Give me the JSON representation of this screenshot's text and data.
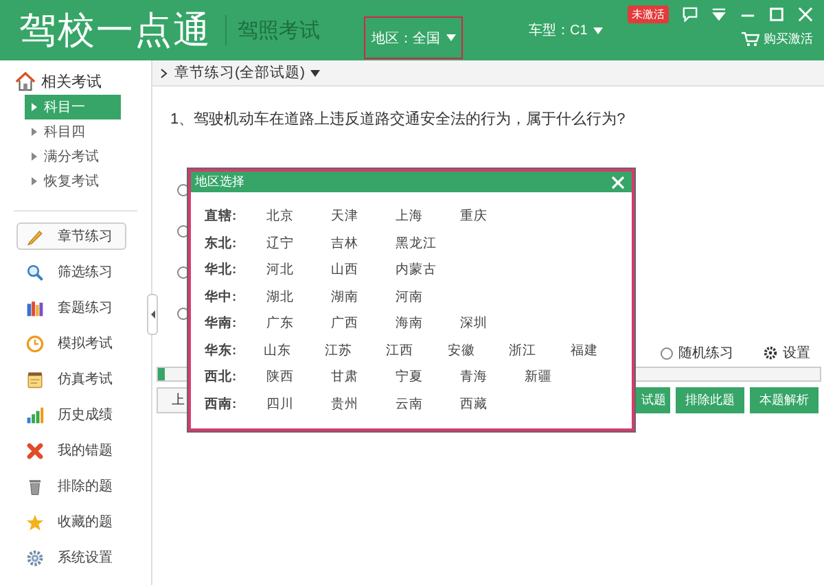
{
  "header": {
    "app_title": "驾校一点通",
    "subtitle": "驾照考试",
    "region_selector": {
      "label": "地区：全国",
      "highlighted": true
    },
    "car_type": "车型：C1",
    "activation_badge": "未激活",
    "buy_link": "购买激活"
  },
  "sidebar": {
    "heading": "相关考试",
    "exams": [
      {
        "label": "科目一",
        "selected": true
      },
      {
        "label": "科目四",
        "selected": false
      },
      {
        "label": "满分考试",
        "selected": false
      },
      {
        "label": "恢复考试",
        "selected": false
      }
    ],
    "menu": [
      {
        "label": "章节练习",
        "selected": true
      },
      {
        "label": "筛选练习",
        "selected": false
      },
      {
        "label": "套题练习",
        "selected": false
      },
      {
        "label": "模拟考试",
        "selected": false
      },
      {
        "label": "仿真考试",
        "selected": false
      },
      {
        "label": "历史成绩",
        "selected": false
      },
      {
        "label": "我的错题",
        "selected": false
      },
      {
        "label": "排除的题",
        "selected": false
      },
      {
        "label": "收藏的题",
        "selected": false
      },
      {
        "label": "系统设置",
        "selected": false
      }
    ]
  },
  "breadcrumb": "章节练习(全部试题)",
  "question": "1、驾驶机动车在道路上违反道路交通安全法的行为，属于什么行为?",
  "answer_options": [
    {
      "selected": false
    },
    {
      "selected": false
    },
    {
      "selected": false
    },
    {
      "selected": false
    }
  ],
  "random_practice": {
    "label": "随机练习",
    "selected": false
  },
  "settings": "设置",
  "progress": {
    "level": 0.01
  },
  "previous_button": "上",
  "action_buttons": [
    "试题",
    "排除此题",
    "本题解析"
  ],
  "dialog": {
    "title": "地区选择",
    "rows": [
      {
        "label": "直辖:",
        "cities": [
          "北京",
          "天津",
          "上海",
          "重庆"
        ]
      },
      {
        "label": "东北:",
        "cities": [
          "辽宁",
          "吉林",
          "黑龙江"
        ]
      },
      {
        "label": "华北:",
        "cities": [
          "河北",
          "山西",
          "内蒙古"
        ]
      },
      {
        "label": "华中:",
        "cities": [
          "湖北",
          "湖南",
          "河南"
        ]
      },
      {
        "label": "华南:",
        "cities": [
          "广东",
          "广西",
          "海南",
          "深圳"
        ]
      },
      {
        "label": "华东:",
        "cities": [
          "山东",
          "江苏",
          "江西",
          "安徽",
          "浙江",
          "福建"
        ]
      },
      {
        "label": "西北:",
        "cities": [
          "陕西",
          "甘肃",
          "宁夏",
          "青海",
          "新疆"
        ]
      },
      {
        "label": "西南:",
        "cities": [
          "四川",
          "贵州",
          "云南",
          "西藏"
        ]
      }
    ]
  }
}
